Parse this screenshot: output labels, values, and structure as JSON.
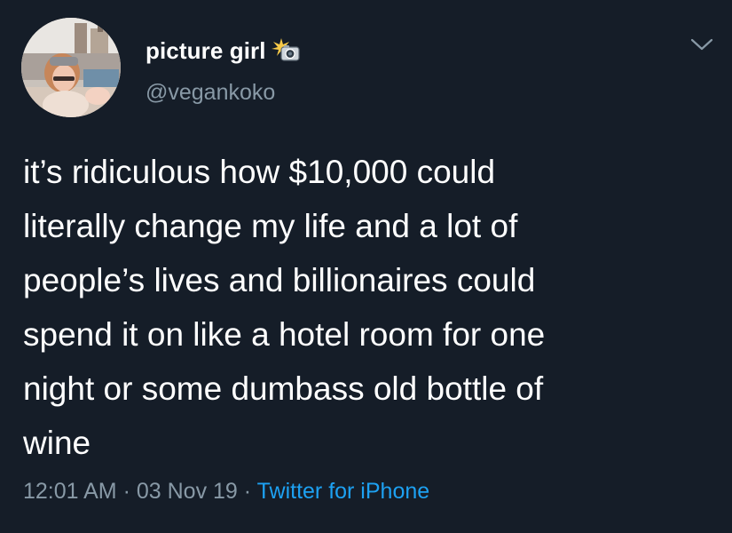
{
  "user": {
    "display_name": "picture girl",
    "username": "@vegankoko",
    "badge_icon": "camera-flash-icon"
  },
  "tweet": {
    "text": "it’s ridiculous how $10,000 could\nliterally change my life and a lot of\npeople’s lives and billionaires could\nspend it on like a hotel room for one\nnight or some dumbass old bottle of\nwine"
  },
  "meta": {
    "time": "12:01 AM",
    "separator": "·",
    "date": "03 Nov 19",
    "source": "Twitter for iPhone"
  },
  "colors": {
    "background": "#151d28",
    "text": "#ffffff",
    "secondary": "#8899a6",
    "link": "#1da1f2"
  }
}
